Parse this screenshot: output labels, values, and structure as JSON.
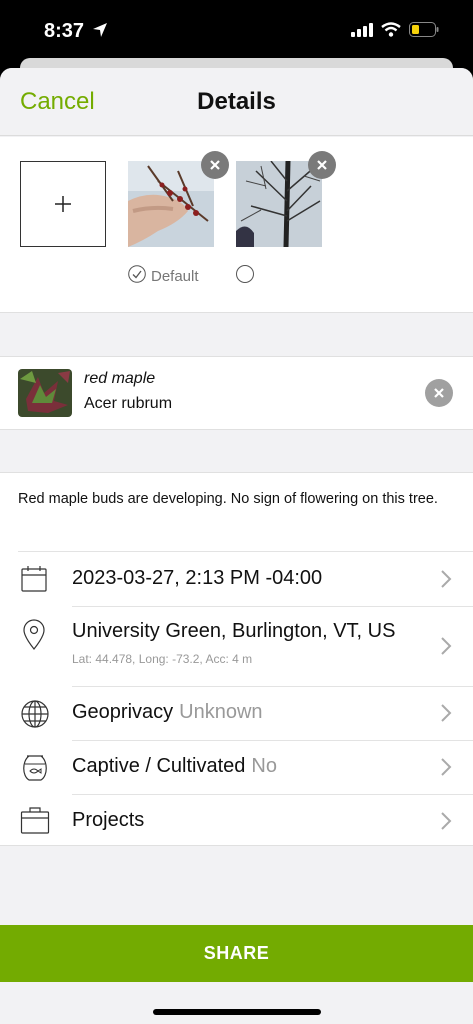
{
  "status": {
    "time": "8:37"
  },
  "nav": {
    "cancel": "Cancel",
    "title": "Details"
  },
  "photos": {
    "default_label": "Default"
  },
  "taxon": {
    "common_name": "red maple",
    "scientific_name": "Acer rubrum"
  },
  "notes": "Red maple buds are developing. No sign of flowering on this tree.",
  "rows": {
    "date": "2023-03-27, 2:13 PM -04:00",
    "location": "University Green, Burlington, VT, US",
    "location_meta": "Lat: 44.478, Long: -73.2, Acc: 4 m",
    "geoprivacy": "Geoprivacy",
    "geoprivacy_value": "Unknown",
    "captive": "Captive / Cultivated",
    "captive_value": "No",
    "projects": "Projects"
  },
  "share": "SHARE",
  "colors": {
    "accent": "#74ac00",
    "share_bg": "#73ab01"
  }
}
